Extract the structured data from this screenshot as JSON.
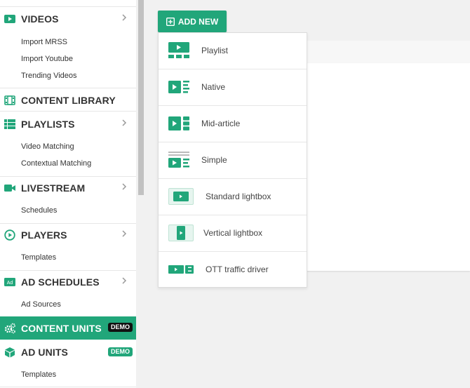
{
  "sidebar": {
    "sections": [
      {
        "key": "videos",
        "label": "VIDEOS",
        "has_chevron": true,
        "subitems": [
          "Import MRSS",
          "Import Youtube",
          "Trending Videos"
        ]
      },
      {
        "key": "content_library",
        "label": "CONTENT LIBRARY",
        "has_chevron": false,
        "subitems": []
      },
      {
        "key": "playlists",
        "label": "PLAYLISTS",
        "has_chevron": true,
        "subitems": [
          "Video Matching",
          "Contextual Matching"
        ]
      },
      {
        "key": "livestream",
        "label": "LIVESTREAM",
        "has_chevron": true,
        "subitems": [
          "Schedules"
        ]
      },
      {
        "key": "players",
        "label": "PLAYERS",
        "has_chevron": true,
        "subitems": [
          "Templates"
        ]
      },
      {
        "key": "ad_schedules",
        "label": "AD SCHEDULES",
        "has_chevron": true,
        "icon_text": "Ad",
        "subitems": [
          "Ad Sources"
        ]
      },
      {
        "key": "content_units",
        "label": "CONTENT UNITS",
        "active": true,
        "badge": "DEMO",
        "subitems": []
      },
      {
        "key": "ad_units",
        "label": "AD UNITS",
        "badge": "DEMO",
        "subitems": [
          "Templates"
        ]
      }
    ]
  },
  "add_button": {
    "label": "ADD NEW"
  },
  "menu": {
    "items": [
      {
        "label": "Playlist",
        "icon": "playlist-icon"
      },
      {
        "label": "Native",
        "icon": "native-icon"
      },
      {
        "label": "Mid-article",
        "icon": "mid-article-icon"
      },
      {
        "label": "Simple",
        "icon": "simple-icon"
      },
      {
        "label": "Standard lightbox",
        "icon": "standard-lightbox-icon"
      },
      {
        "label": "Vertical lightbox",
        "icon": "vertical-lightbox-icon"
      },
      {
        "label": "OTT traffic driver",
        "icon": "ott-traffic-driver-icon"
      }
    ]
  },
  "colors": {
    "accent": "#21a67a",
    "badge_dark": "#111111",
    "text": "#333333"
  }
}
